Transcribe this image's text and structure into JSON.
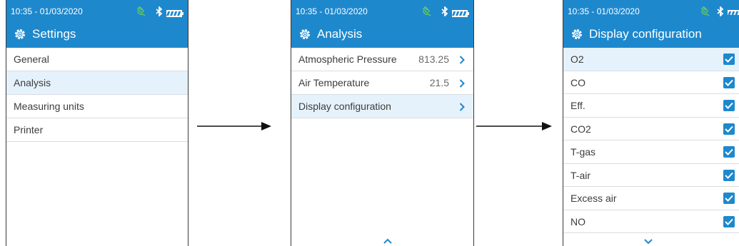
{
  "status": {
    "time": "10:35 - 01/03/2020"
  },
  "colors": {
    "header": "#1e88cd",
    "selected_row": "#e6f2fb",
    "plug": "#5cc46b"
  },
  "screens": [
    {
      "title": "Settings",
      "items": [
        {
          "label": "General",
          "selected": false
        },
        {
          "label": "Analysis",
          "selected": true
        },
        {
          "label": "Measuring units",
          "selected": false
        },
        {
          "label": "Printer",
          "selected": false
        }
      ]
    },
    {
      "title": "Analysis",
      "items": [
        {
          "label": "Atmospheric Pressure",
          "value": "813.25",
          "selected": false
        },
        {
          "label": "Air Temperature",
          "value": "21.5",
          "selected": false
        },
        {
          "label": "Display configuration",
          "value": "",
          "selected": true
        }
      ]
    },
    {
      "title": "Display configuration",
      "items": [
        {
          "label": "O2",
          "checked": true,
          "selected": true
        },
        {
          "label": "CO",
          "checked": true,
          "selected": false
        },
        {
          "label": "Eff.",
          "checked": true,
          "selected": false
        },
        {
          "label": "CO2",
          "checked": true,
          "selected": false
        },
        {
          "label": "T-gas",
          "checked": true,
          "selected": false
        },
        {
          "label": "T-air",
          "checked": true,
          "selected": false
        },
        {
          "label": "Excess air",
          "checked": true,
          "selected": false
        },
        {
          "label": "NO",
          "checked": true,
          "selected": false
        }
      ]
    }
  ],
  "icons": {
    "gear": "gear-icon",
    "bluetooth": "bluetooth-icon",
    "battery": "battery-icon",
    "plug": "plug-icon",
    "chevron": "chevron-right-icon",
    "check": "checkbox-checked-icon",
    "arrow": "arrow-right-icon"
  }
}
